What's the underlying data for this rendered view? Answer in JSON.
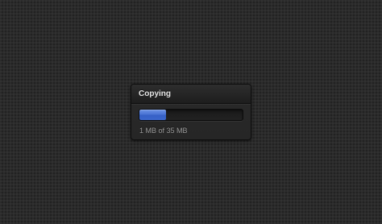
{
  "dialog": {
    "title": "Copying",
    "progress_fraction": 0.26,
    "status_text": "1 MB of 35 MB"
  },
  "colors": {
    "background": "#2b2b2b",
    "progress_accent": "#4a74d4",
    "title_text": "#e6e6e6",
    "status_text": "#9a9a9a"
  }
}
